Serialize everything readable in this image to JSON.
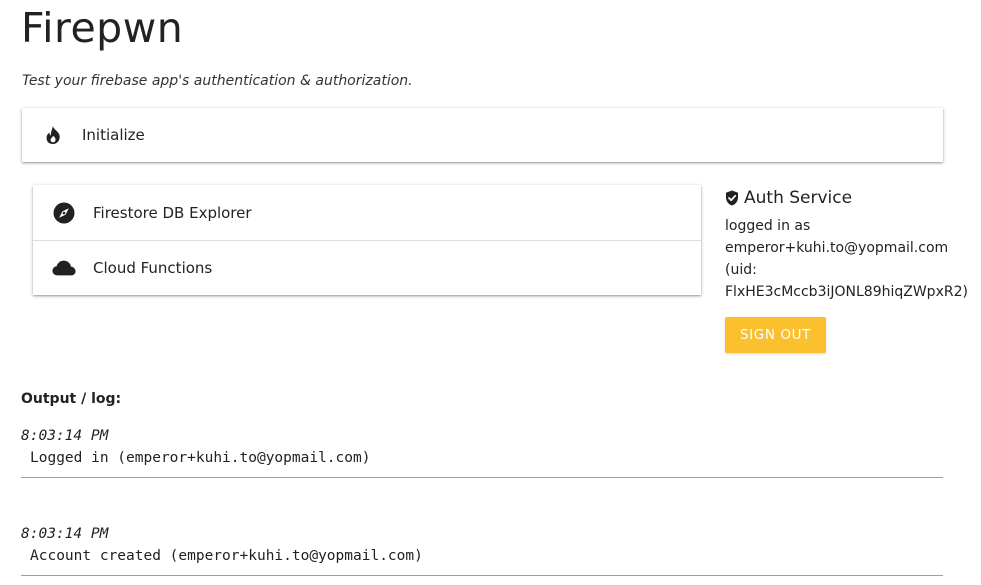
{
  "header": {
    "title": "Firepwn",
    "subtitle": "Test your firebase app's authentication & authorization."
  },
  "init_card": {
    "icon": "flame-icon",
    "label": "Initialize"
  },
  "menu": {
    "items": [
      {
        "icon": "compass-icon",
        "label": "Firestore DB Explorer"
      },
      {
        "icon": "cloud-icon",
        "label": "Cloud Functions"
      }
    ]
  },
  "auth": {
    "icon": "shield-check-icon",
    "title": "Auth Service",
    "lines": [
      "logged in as",
      "emperor+kuhi.to@yopmail.com",
      "(uid:",
      "FlxHE3cMccb3iJONL89hiqZWpxR2)"
    ],
    "signout_label": "SIGN OUT",
    "signout_color": "#fbc02d"
  },
  "output": {
    "label": "Output / log:",
    "entries": [
      {
        "time": "8:03:14 PM",
        "message": "Logged in (emperor+kuhi.to@yopmail.com)"
      },
      {
        "time": "8:03:14 PM",
        "message": "Account created (emperor+kuhi.to@yopmail.com)"
      }
    ]
  }
}
